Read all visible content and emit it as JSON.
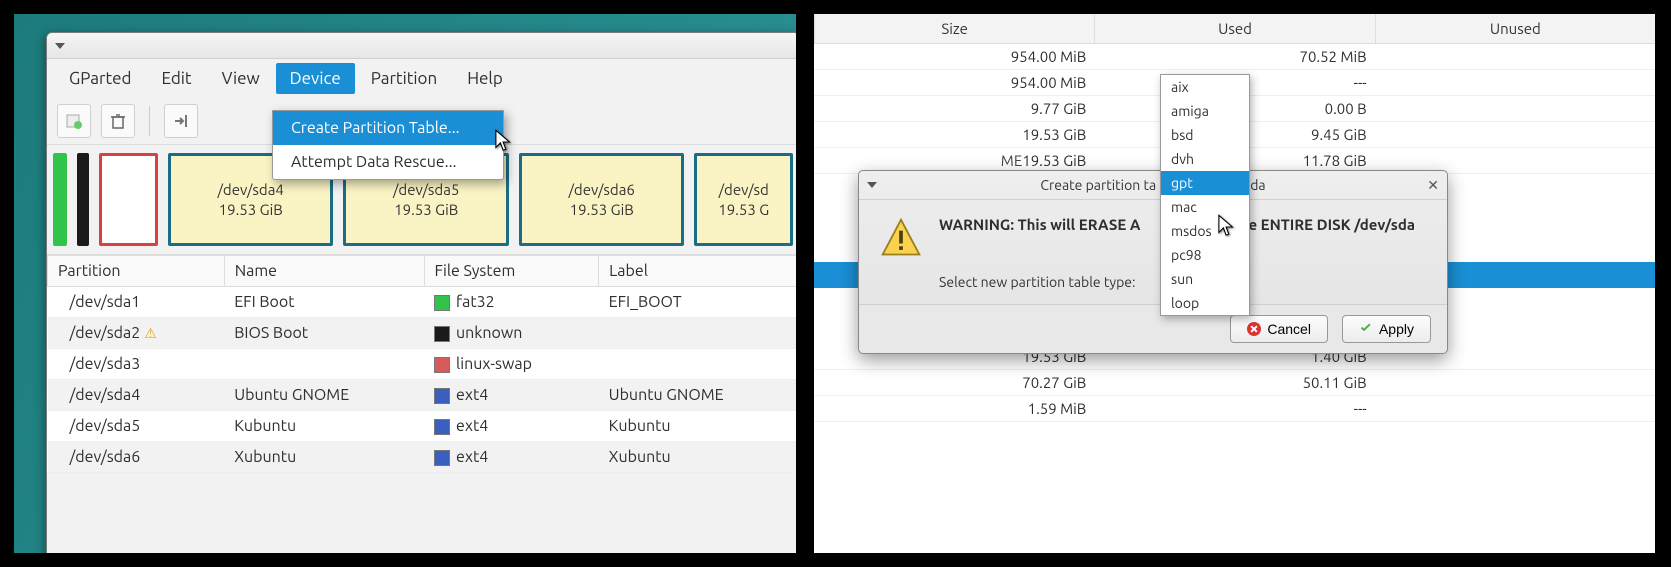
{
  "left": {
    "menus": [
      "GParted",
      "Edit",
      "View",
      "Device",
      "Partition",
      "Help"
    ],
    "activeMenuIndex": 3,
    "deviceMenu": {
      "items": [
        "Create Partition Table...",
        "Attempt Data Rescue..."
      ],
      "hoverIndex": 0
    },
    "graph": [
      {
        "kind": "green"
      },
      {
        "kind": "black"
      },
      {
        "kind": "red"
      },
      {
        "kind": "yellow",
        "name": "/dev/sda4",
        "size": "19.53 GiB"
      },
      {
        "kind": "yellow",
        "name": "/dev/sda5",
        "size": "19.53 GiB"
      },
      {
        "kind": "yellow",
        "name": "/dev/sda6",
        "size": "19.53 GiB"
      },
      {
        "kind": "yellow",
        "name": "/dev/sd",
        "size": "19.53 G"
      }
    ],
    "tableHeaders": [
      "Partition",
      "Name",
      "File System",
      "Label"
    ],
    "tableRows": [
      {
        "partition": "/dev/sda1",
        "name": "EFI Boot",
        "fs": "fat32",
        "fsClass": "fs-fat32",
        "label": "EFI_BOOT",
        "warn": false
      },
      {
        "partition": "/dev/sda2",
        "name": "BIOS Boot",
        "fs": "unknown",
        "fsClass": "fs-unknown",
        "label": "",
        "warn": true
      },
      {
        "partition": "/dev/sda3",
        "name": "",
        "fs": "linux-swap",
        "fsClass": "fs-swap",
        "label": "",
        "warn": false
      },
      {
        "partition": "/dev/sda4",
        "name": "Ubuntu GNOME",
        "fs": "ext4",
        "fsClass": "fs-ext4",
        "label": "Ubuntu GNOME",
        "warn": false
      },
      {
        "partition": "/dev/sda5",
        "name": "Kubuntu",
        "fs": "ext4",
        "fsClass": "fs-ext4",
        "label": "Kubuntu",
        "warn": false
      },
      {
        "partition": "/dev/sda6",
        "name": "Xubuntu",
        "fs": "ext4",
        "fsClass": "fs-ext4",
        "label": "Xubuntu",
        "warn": false
      }
    ]
  },
  "right": {
    "columns": [
      "Size",
      "Used",
      "Unused"
    ],
    "upperRows": [
      {
        "label": "",
        "size": "954.00 MiB",
        "used": "70.52 MiB"
      },
      {
        "label": "",
        "size": "954.00 MiB",
        "used": "---"
      },
      {
        "label": "",
        "size": "9.77 GiB",
        "used": "0.00 B"
      },
      {
        "label": "",
        "size": "19.53 GiB",
        "used": "9.45 GiB"
      },
      {
        "label": "ME",
        "size": "19.53 GiB",
        "used": "11.78 GiB"
      }
    ],
    "lowerRows": [
      {
        "size": "19.53 GiB",
        "used": "1.40 GiB"
      },
      {
        "size": "70.27 GiB",
        "used": "50.11 GiB"
      },
      {
        "size": "1.59 MiB",
        "used": "---"
      }
    ],
    "dialog": {
      "title_prefix": "Create partition ta",
      "title_suffix": "sda",
      "warning_pre": "WARNING:  This will ERASE A",
      "warning_post": " the ENTIRE DISK /dev/sda",
      "selectLabel": "Select new partition table type:",
      "options": [
        "aix",
        "amiga",
        "bsd",
        "dvh",
        "gpt",
        "mac",
        "msdos",
        "pc98",
        "sun",
        "loop"
      ],
      "selected": "gpt",
      "cancel": "Cancel",
      "apply": "Apply"
    }
  }
}
